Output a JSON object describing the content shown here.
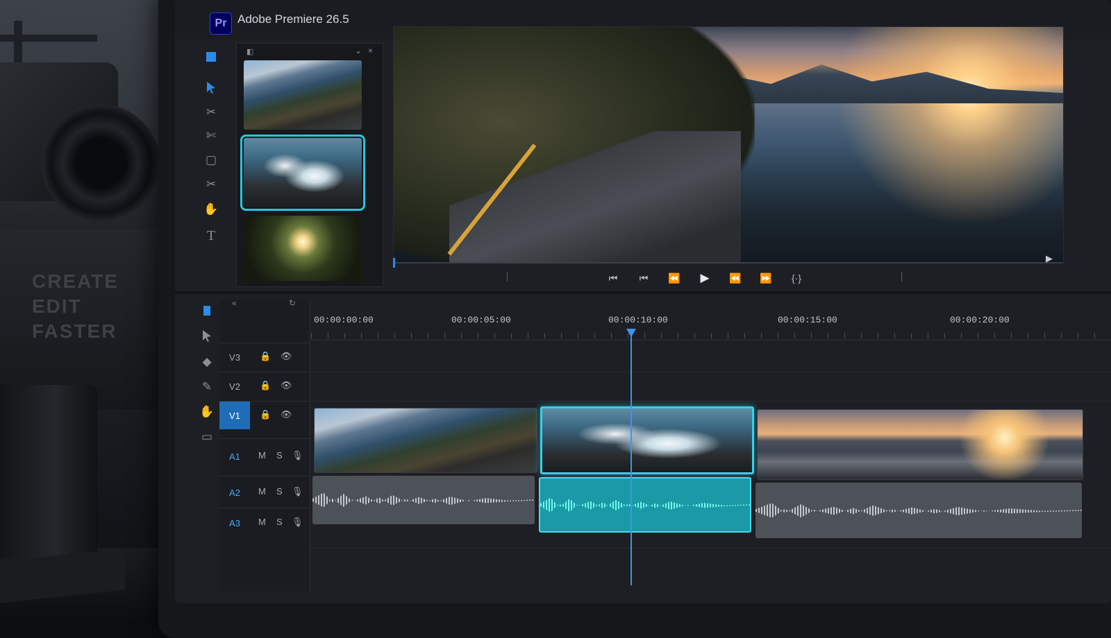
{
  "app": {
    "logo_text": "Pr",
    "title": "Adobe Premiere 26.5"
  },
  "bin": {
    "label": "◧",
    "collapse_glyph": "⌄",
    "close_glyph": "×",
    "thumbnails": [
      "coastal-road",
      "ocean-waves",
      "forest-sunburst"
    ],
    "selected_index": 1
  },
  "program_monitor": {
    "end_marker": "▶",
    "transport": [
      "⏮",
      "⏮",
      "⏪",
      "▶",
      "⏪",
      "⏩",
      "{·}"
    ]
  },
  "timeline": {
    "header_left_glyph": "«",
    "header_right_glyph": "↻",
    "timecodes": [
      "00:00:00:00",
      "00:00:05:00",
      "00:00:10:00",
      "00:00:15:00",
      "00:00:20:00"
    ],
    "tracks": [
      {
        "label": "V3",
        "type": "video",
        "lock": "🔒",
        "eye": "👁"
      },
      {
        "label": "V2",
        "type": "video",
        "lock": "🔒",
        "eye": "👁"
      },
      {
        "label": "V1",
        "type": "video",
        "lock": "🔒",
        "eye": "👁",
        "active": true
      },
      {
        "label": "A1",
        "type": "audio",
        "m": "M",
        "s": "S",
        "mic": "🎙"
      },
      {
        "label": "A2",
        "type": "audio",
        "m": "M",
        "s": "S",
        "mic": "🎙"
      },
      {
        "label": "A3",
        "type": "audio",
        "m": "M",
        "s": "S",
        "mic": "🎙"
      }
    ],
    "video_clips": [
      "coastal-road",
      "ocean-waves",
      "sunset-sea"
    ],
    "selected_clip_index": 1
  },
  "scene": {
    "box_text": [
      "CREATE",
      "EDIT",
      "FASTER"
    ]
  },
  "colors": {
    "accent": "#2d8ceb",
    "selection": "#35d0ea",
    "premiere_badge": "#00005b"
  }
}
